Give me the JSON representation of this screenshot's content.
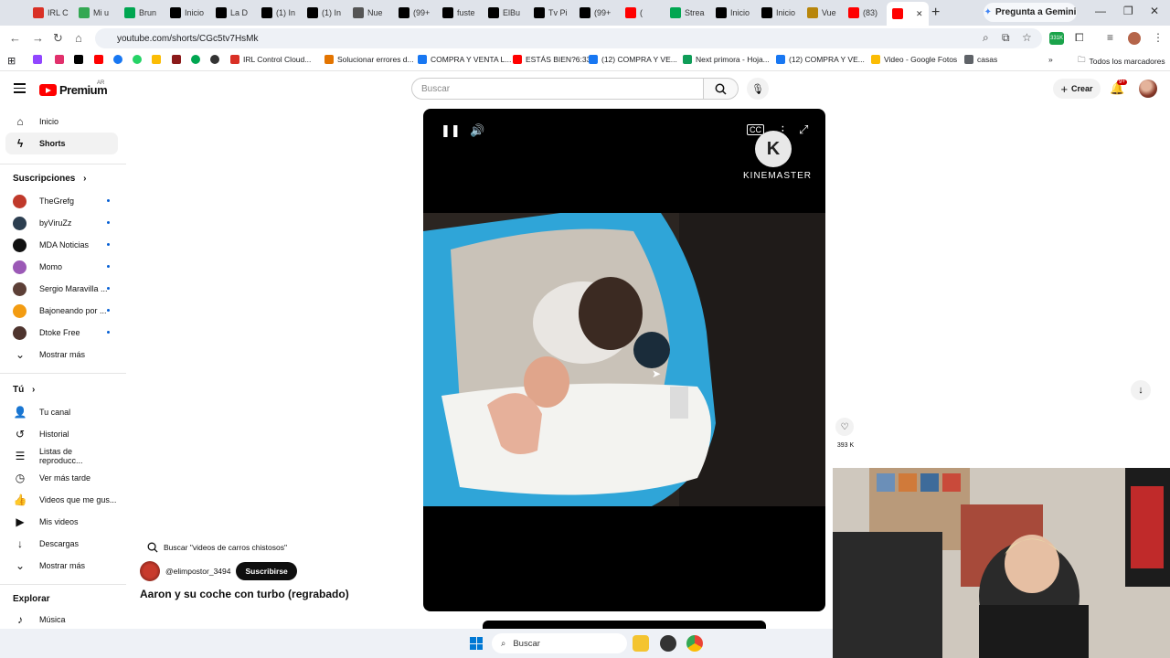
{
  "browser": {
    "tabs": [
      {
        "label": "IRL C",
        "color": "#d93025"
      },
      {
        "label": "Mi u",
        "color": "#34a853"
      },
      {
        "label": "Brun",
        "color": "#00a651"
      },
      {
        "label": "Inicio",
        "color": "#000000"
      },
      {
        "label": "La D",
        "color": "#000000"
      },
      {
        "label": "(1) In",
        "color": "#000000"
      },
      {
        "label": "(1) In",
        "color": "#000000"
      },
      {
        "label": "Nue",
        "color": "#555555"
      },
      {
        "label": "(99+",
        "color": "#000000"
      },
      {
        "label": "fuste",
        "color": "#000000"
      },
      {
        "label": "ElBu",
        "color": "#000000"
      },
      {
        "label": "Tv Pi",
        "color": "#000000"
      },
      {
        "label": "(99+",
        "color": "#000000"
      },
      {
        "label": "(",
        "color": "#ff0000"
      },
      {
        "label": "Strea",
        "color": "#00a651"
      },
      {
        "label": "Inicio",
        "color": "#000000"
      },
      {
        "label": "Inicio",
        "color": "#000000"
      },
      {
        "label": "Vue",
        "color": "#b8860b"
      },
      {
        "label": "(83)",
        "color": "#ff0000"
      },
      {
        "label": "",
        "color": "#ff0000"
      }
    ],
    "gemini_label": "Pregunta a Gemini",
    "url": "youtube.com/shorts/CGc5tv7HsMk",
    "extension_badge": "331K",
    "bookmarks": [
      {
        "label": "IRL Control Cloud...",
        "color": "#d93025"
      },
      {
        "label": "Solucionar errores d...",
        "color": "#e37400"
      },
      {
        "label": "COMPRA Y VENTA L...",
        "color": "#1877f2"
      },
      {
        "label": "ESTÁS BIEN?6:33",
        "color": "#ff0000"
      },
      {
        "label": "(12) COMPRA Y VE...",
        "color": "#1877f2"
      },
      {
        "label": "Next primora - Hoja...",
        "color": "#0f9d58"
      },
      {
        "label": "(12) COMPRA Y VE...",
        "color": "#1877f2"
      },
      {
        "label": "Video - Google Fotos",
        "color": "#fbbc04"
      },
      {
        "label": "casas",
        "color": "#5f6368"
      }
    ],
    "all_bookmarks": "Todos los marcadores"
  },
  "yt": {
    "logo_text": "Premium",
    "logo_country": "AR",
    "search_placeholder": "Buscar",
    "crear": "Crear",
    "bell_badge": "9+"
  },
  "sidebar": {
    "main": [
      {
        "label": "Inicio",
        "icon": "home-icon"
      },
      {
        "label": "Shorts",
        "icon": "shorts-icon"
      }
    ],
    "subs_title": "Suscripciones",
    "subs": [
      {
        "label": "TheGrefg",
        "color": "#c0392b"
      },
      {
        "label": "byViruZz",
        "color": "#2c3e50"
      },
      {
        "label": "MDA Noticias",
        "color": "#111111"
      },
      {
        "label": "Momo",
        "color": "#9b59b6"
      },
      {
        "label": "Sergio Maravilla ...",
        "color": "#5d4037"
      },
      {
        "label": "Bajoneando por ...",
        "color": "#f39c12"
      },
      {
        "label": "Dtoke Free",
        "color": "#4e342e"
      }
    ],
    "show_more": "Mostrar más",
    "you_title": "Tú",
    "you": [
      {
        "label": "Tu canal",
        "glyph": "👤"
      },
      {
        "label": "Historial",
        "glyph": "↺"
      },
      {
        "label": "Listas de reproducc...",
        "glyph": "☰"
      },
      {
        "label": "Ver más tarde",
        "glyph": "◷"
      },
      {
        "label": "Videos que me gus...",
        "glyph": "👍"
      },
      {
        "label": "Mis videos",
        "glyph": "▶"
      },
      {
        "label": "Descargas",
        "glyph": "↓"
      }
    ],
    "show_more_2": "Mostrar más",
    "explore_title": "Explorar",
    "explore": [
      {
        "label": "Música",
        "glyph": "♪"
      }
    ]
  },
  "short": {
    "watermark": "KINEMASTER",
    "like_count": "393 K",
    "search_suggestion": "Buscar \"videos de carros chistosos\"",
    "channel": "@elimpostor_3494",
    "subscribe": "Suscribirse",
    "title": "Aaron y su coche con turbo (regrabado)"
  },
  "taskbar": {
    "search": "Buscar"
  }
}
